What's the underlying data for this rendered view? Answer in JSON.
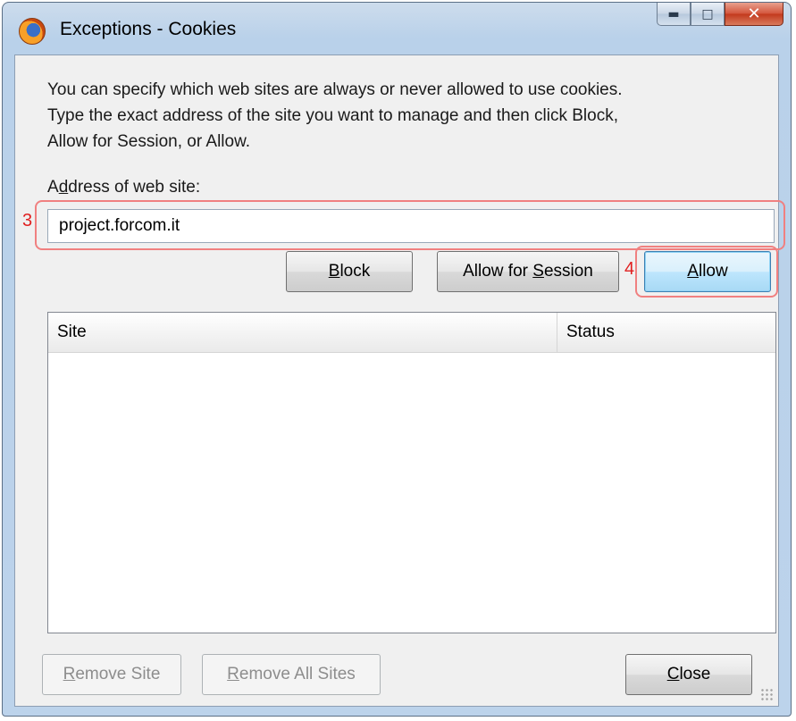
{
  "window": {
    "title": "Exceptions - Cookies",
    "app_icon": "firefox-icon",
    "controls": {
      "minimize": "minimize-icon",
      "maximize": "maximize-icon",
      "close": "close-icon"
    }
  },
  "description": {
    "line1": "You can specify which web sites are always or never allowed to use cookies.",
    "line2": "Type the exact address of the site you want to manage and then click Block,",
    "line3": "Allow for Session, or Allow."
  },
  "address": {
    "label_pre": "A",
    "label_accel": "d",
    "label_post": "dress of web site:",
    "value": "project.forcom.it"
  },
  "buttons": {
    "block": {
      "accel": "B",
      "rest": "lock"
    },
    "allow_session": {
      "pre": "Allow for ",
      "accel": "S",
      "rest": "ession"
    },
    "allow": {
      "accel": "A",
      "rest": "llow"
    },
    "remove_site": {
      "accel": "R",
      "rest": "emove Site"
    },
    "remove_all": {
      "accel": "R",
      "rest": "emove All Sites"
    },
    "close": {
      "accel": "C",
      "rest": "lose"
    }
  },
  "table": {
    "columns": [
      "Site",
      "Status"
    ],
    "rows": []
  },
  "annotations": {
    "step3": "3",
    "step4": "4",
    "highlight_color": "#f08080",
    "marker_color": "#e02020"
  }
}
